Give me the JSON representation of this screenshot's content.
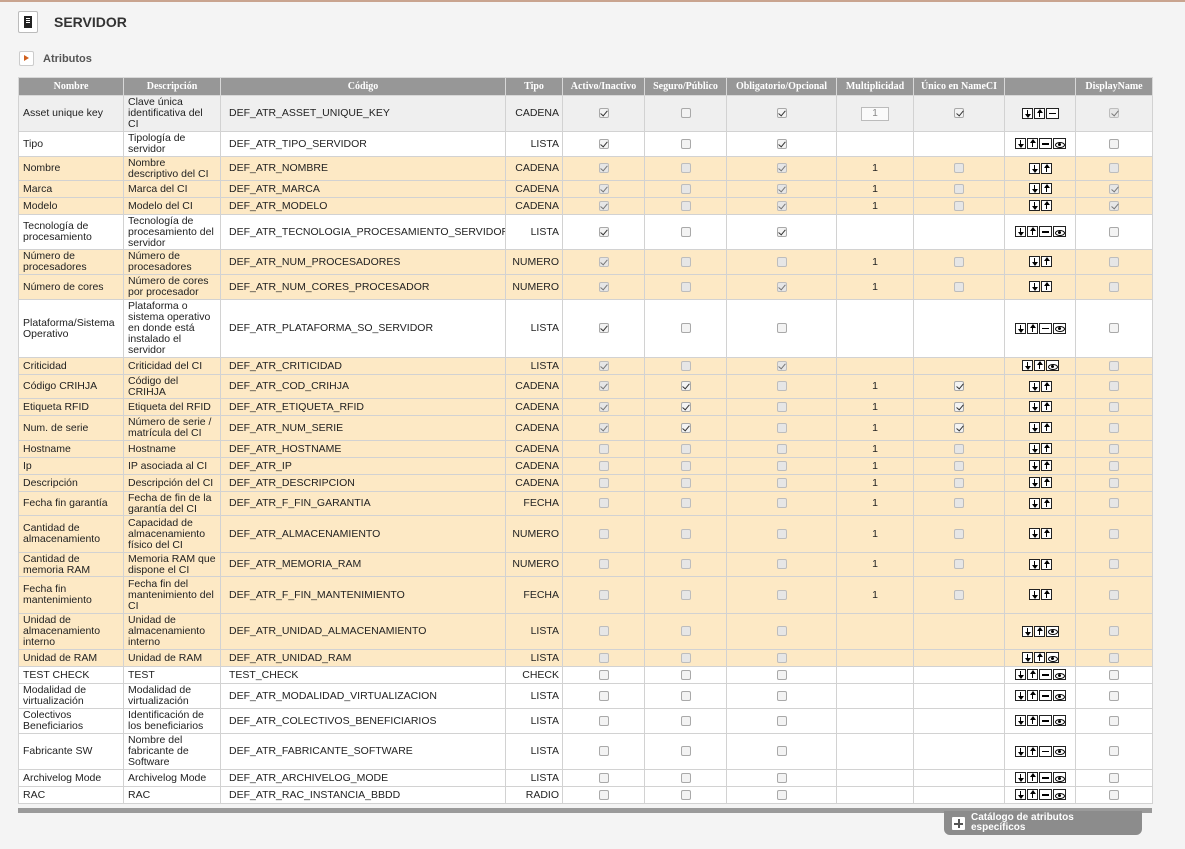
{
  "page": {
    "title": "SERVIDOR",
    "section_label": "Atributos"
  },
  "columns": [
    "Nombre",
    "Descripción",
    "Código",
    "Tipo",
    "Activo/Inactivo",
    "Seguro/Público",
    "Obligatorio/Opcional",
    "Multiplicidad",
    "Único en NameCI",
    "",
    "DisplayName"
  ],
  "rows": [
    {
      "nombre": "Asset unique key",
      "descripcion": "Clave única identificativa del CI",
      "codigo": "DEF_ATR_ASSET_UNIQUE_KEY",
      "tipo": "CADENA",
      "activo": true,
      "activo_dis": false,
      "seguro": false,
      "seguro_dis": false,
      "obligatorio": true,
      "obligatorio_dis": false,
      "mult": "1",
      "mult_box": true,
      "unico": true,
      "unico_show": true,
      "unico_dis": false,
      "actions": [
        "down",
        "up",
        "minus"
      ],
      "display": true,
      "display_dis": true,
      "style": "gray",
      "h": 36
    },
    {
      "nombre": "Tipo",
      "descripcion": "Tipología de servidor",
      "codigo": "DEF_ATR_TIPO_SERVIDOR",
      "tipo": "LISTA",
      "activo": true,
      "activo_dis": false,
      "seguro": false,
      "seguro_dis": false,
      "obligatorio": true,
      "obligatorio_dis": false,
      "mult": "",
      "mult_box": false,
      "unico": false,
      "unico_show": false,
      "unico_dis": false,
      "actions": [
        "down",
        "up",
        "minus",
        "eye"
      ],
      "display": false,
      "display_dis": false,
      "style": "white",
      "h": 25
    },
    {
      "nombre": "Nombre",
      "descripcion": "Nombre descriptivo del CI",
      "codigo": "DEF_ATR_NOMBRE",
      "tipo": "CADENA",
      "activo": true,
      "activo_dis": true,
      "seguro": false,
      "seguro_dis": true,
      "obligatorio": true,
      "obligatorio_dis": true,
      "mult": "1",
      "mult_box": false,
      "unico": false,
      "unico_show": true,
      "unico_dis": true,
      "actions": [
        "down",
        "up"
      ],
      "display": false,
      "display_dis": true,
      "style": "orange",
      "h": 24
    },
    {
      "nombre": "Marca",
      "descripcion": "Marca del CI",
      "codigo": "DEF_ATR_MARCA",
      "tipo": "CADENA",
      "activo": true,
      "activo_dis": true,
      "seguro": false,
      "seguro_dis": true,
      "obligatorio": true,
      "obligatorio_dis": true,
      "mult": "1",
      "mult_box": false,
      "unico": false,
      "unico_show": true,
      "unico_dis": true,
      "actions": [
        "down",
        "up"
      ],
      "display": true,
      "display_dis": true,
      "style": "orange",
      "h": 17
    },
    {
      "nombre": "Modelo",
      "descripcion": "Modelo del CI",
      "codigo": "DEF_ATR_MODELO",
      "tipo": "CADENA",
      "activo": true,
      "activo_dis": true,
      "seguro": false,
      "seguro_dis": true,
      "obligatorio": true,
      "obligatorio_dis": true,
      "mult": "1",
      "mult_box": false,
      "unico": false,
      "unico_show": true,
      "unico_dis": true,
      "actions": [
        "down",
        "up"
      ],
      "display": true,
      "display_dis": true,
      "style": "orange",
      "h": 17
    },
    {
      "nombre": "Tecnología de procesamiento",
      "descripcion": "Tecnología de procesamiento del servidor",
      "codigo": "DEF_ATR_TECNOLOGIA_PROCESAMIENTO_SERVIDOR",
      "tipo": "LISTA",
      "activo": true,
      "activo_dis": false,
      "seguro": false,
      "seguro_dis": false,
      "obligatorio": true,
      "obligatorio_dis": false,
      "mult": "",
      "mult_box": false,
      "unico": false,
      "unico_show": false,
      "unico_dis": false,
      "actions": [
        "down",
        "up",
        "minus",
        "eye"
      ],
      "display": false,
      "display_dis": false,
      "style": "white",
      "h": 35
    },
    {
      "nombre": "Número de procesadores",
      "descripcion": "Número de procesadores",
      "codigo": "DEF_ATR_NUM_PROCESADORES",
      "tipo": "NUMERO",
      "activo": true,
      "activo_dis": true,
      "seguro": false,
      "seguro_dis": true,
      "obligatorio": false,
      "obligatorio_dis": true,
      "mult": "1",
      "mult_box": false,
      "unico": false,
      "unico_show": true,
      "unico_dis": true,
      "actions": [
        "down",
        "up"
      ],
      "display": false,
      "display_dis": true,
      "style": "orange",
      "h": 25
    },
    {
      "nombre": "Número de cores",
      "descripcion": "Número de cores por procesador",
      "codigo": "DEF_ATR_NUM_CORES_PROCESADOR",
      "tipo": "NUMERO",
      "activo": true,
      "activo_dis": true,
      "seguro": false,
      "seguro_dis": true,
      "obligatorio": true,
      "obligatorio_dis": true,
      "mult": "1",
      "mult_box": false,
      "unico": false,
      "unico_show": true,
      "unico_dis": true,
      "actions": [
        "down",
        "up"
      ],
      "display": false,
      "display_dis": true,
      "style": "orange",
      "h": 25
    },
    {
      "nombre": "Plataforma/Sistema Operativo",
      "descripcion": "Plataforma o sistema operativo en donde está instalado el servidor",
      "codigo": "DEF_ATR_PLATAFORMA_SO_SERVIDOR",
      "tipo": "LISTA",
      "activo": true,
      "activo_dis": false,
      "seguro": false,
      "seguro_dis": false,
      "obligatorio": false,
      "obligatorio_dis": false,
      "mult": "",
      "mult_box": false,
      "unico": false,
      "unico_show": false,
      "unico_dis": false,
      "actions": [
        "down",
        "up",
        "minus",
        "eye"
      ],
      "display": false,
      "display_dis": false,
      "style": "white",
      "h": 58
    },
    {
      "nombre": "Criticidad",
      "descripcion": "Criticidad del CI",
      "codigo": "DEF_ATR_CRITICIDAD",
      "tipo": "LISTA",
      "activo": true,
      "activo_dis": true,
      "seguro": false,
      "seguro_dis": true,
      "obligatorio": true,
      "obligatorio_dis": true,
      "mult": "",
      "mult_box": false,
      "unico": false,
      "unico_show": false,
      "unico_dis": false,
      "actions": [
        "down",
        "up",
        "eye"
      ],
      "display": false,
      "display_dis": true,
      "style": "orange",
      "h": 17
    },
    {
      "nombre": "Código CRIHJA",
      "descripcion": "Código del CRIHJA",
      "codigo": "DEF_ATR_COD_CRIHJA",
      "tipo": "CADENA",
      "activo": true,
      "activo_dis": true,
      "seguro": true,
      "seguro_dis": false,
      "obligatorio": false,
      "obligatorio_dis": true,
      "mult": "1",
      "mult_box": false,
      "unico": true,
      "unico_show": true,
      "unico_dis": false,
      "actions": [
        "down",
        "up"
      ],
      "display": false,
      "display_dis": true,
      "style": "orange",
      "h": 24
    },
    {
      "nombre": "Etiqueta RFID",
      "descripcion": "Etiqueta del RFID",
      "codigo": "DEF_ATR_ETIQUETA_RFID",
      "tipo": "CADENA",
      "activo": true,
      "activo_dis": true,
      "seguro": true,
      "seguro_dis": false,
      "obligatorio": false,
      "obligatorio_dis": true,
      "mult": "1",
      "mult_box": false,
      "unico": true,
      "unico_show": true,
      "unico_dis": false,
      "actions": [
        "down",
        "up"
      ],
      "display": false,
      "display_dis": true,
      "style": "orange",
      "h": 17
    },
    {
      "nombre": "Num. de serie",
      "descripcion": "Número de serie / matrícula del CI",
      "codigo": "DEF_ATR_NUM_SERIE",
      "tipo": "CADENA",
      "activo": true,
      "activo_dis": true,
      "seguro": true,
      "seguro_dis": false,
      "obligatorio": false,
      "obligatorio_dis": true,
      "mult": "1",
      "mult_box": false,
      "unico": true,
      "unico_show": true,
      "unico_dis": false,
      "actions": [
        "down",
        "up"
      ],
      "display": false,
      "display_dis": true,
      "style": "orange",
      "h": 25
    },
    {
      "nombre": "Hostname",
      "descripcion": "Hostname",
      "codigo": "DEF_ATR_HOSTNAME",
      "tipo": "CADENA",
      "activo": false,
      "activo_dis": true,
      "seguro": false,
      "seguro_dis": true,
      "obligatorio": false,
      "obligatorio_dis": true,
      "mult": "1",
      "mult_box": false,
      "unico": false,
      "unico_show": true,
      "unico_dis": true,
      "actions": [
        "down",
        "up"
      ],
      "display": false,
      "display_dis": true,
      "style": "orange",
      "h": 17
    },
    {
      "nombre": "Ip",
      "descripcion": "IP asociada al CI",
      "codigo": "DEF_ATR_IP",
      "tipo": "CADENA",
      "activo": false,
      "activo_dis": true,
      "seguro": false,
      "seguro_dis": true,
      "obligatorio": false,
      "obligatorio_dis": true,
      "mult": "1",
      "mult_box": false,
      "unico": false,
      "unico_show": true,
      "unico_dis": true,
      "actions": [
        "down",
        "up"
      ],
      "display": false,
      "display_dis": true,
      "style": "orange",
      "h": 17
    },
    {
      "nombre": "Descripción",
      "descripcion": "Descripción del CI",
      "codigo": "DEF_ATR_DESCRIPCION",
      "tipo": "CADENA",
      "activo": false,
      "activo_dis": true,
      "seguro": false,
      "seguro_dis": true,
      "obligatorio": false,
      "obligatorio_dis": true,
      "mult": "1",
      "mult_box": false,
      "unico": false,
      "unico_show": true,
      "unico_dis": true,
      "actions": [
        "down",
        "up"
      ],
      "display": false,
      "display_dis": true,
      "style": "orange",
      "h": 17
    },
    {
      "nombre": "Fecha fin garantía",
      "descripcion": "Fecha de fin de la garantía del CI",
      "codigo": "DEF_ATR_F_FIN_GARANTIA",
      "tipo": "FECHA",
      "activo": false,
      "activo_dis": true,
      "seguro": false,
      "seguro_dis": true,
      "obligatorio": false,
      "obligatorio_dis": true,
      "mult": "1",
      "mult_box": false,
      "unico": false,
      "unico_show": true,
      "unico_dis": true,
      "actions": [
        "down",
        "up"
      ],
      "display": false,
      "display_dis": true,
      "style": "orange",
      "h": 24
    },
    {
      "nombre": "Cantidad de almacenamiento",
      "descripcion": "Capacidad de almacenamiento físico del CI",
      "codigo": "DEF_ATR_ALMACENAMIENTO",
      "tipo": "NUMERO",
      "activo": false,
      "activo_dis": true,
      "seguro": false,
      "seguro_dis": true,
      "obligatorio": false,
      "obligatorio_dis": true,
      "mult": "1",
      "mult_box": false,
      "unico": false,
      "unico_show": true,
      "unico_dis": true,
      "actions": [
        "down",
        "up"
      ],
      "display": false,
      "display_dis": true,
      "style": "orange",
      "h": 37
    },
    {
      "nombre": "Cantidad de memoria RAM",
      "descripcion": "Memoria RAM que dispone el CI",
      "codigo": "DEF_ATR_MEMORIA_RAM",
      "tipo": "NUMERO",
      "activo": false,
      "activo_dis": true,
      "seguro": false,
      "seguro_dis": true,
      "obligatorio": false,
      "obligatorio_dis": true,
      "mult": "1",
      "mult_box": false,
      "unico": false,
      "unico_show": true,
      "unico_dis": true,
      "actions": [
        "down",
        "up"
      ],
      "display": false,
      "display_dis": true,
      "style": "orange",
      "h": 24
    },
    {
      "nombre": "Fecha fin mantenimiento",
      "descripcion": "Fecha fin del mantenimiento del CI",
      "codigo": "DEF_ATR_F_FIN_MANTENIMIENTO",
      "tipo": "FECHA",
      "activo": false,
      "activo_dis": true,
      "seguro": false,
      "seguro_dis": true,
      "obligatorio": false,
      "obligatorio_dis": true,
      "mult": "1",
      "mult_box": false,
      "unico": false,
      "unico_show": true,
      "unico_dis": true,
      "actions": [
        "down",
        "up"
      ],
      "display": false,
      "display_dis": true,
      "style": "orange",
      "h": 37
    },
    {
      "nombre": "Unidad de almacenamiento interno",
      "descripcion": "Unidad de almacenamiento interno",
      "codigo": "DEF_ATR_UNIDAD_ALMACENAMIENTO",
      "tipo": "LISTA",
      "activo": false,
      "activo_dis": true,
      "seguro": false,
      "seguro_dis": true,
      "obligatorio": false,
      "obligatorio_dis": true,
      "mult": "",
      "mult_box": false,
      "unico": false,
      "unico_show": false,
      "unico_dis": false,
      "actions": [
        "down",
        "up",
        "eye"
      ],
      "display": false,
      "display_dis": true,
      "style": "orange",
      "h": 36
    },
    {
      "nombre": "Unidad de RAM",
      "descripcion": "Unidad de RAM",
      "codigo": "DEF_ATR_UNIDAD_RAM",
      "tipo": "LISTA",
      "activo": false,
      "activo_dis": true,
      "seguro": false,
      "seguro_dis": true,
      "obligatorio": false,
      "obligatorio_dis": true,
      "mult": "",
      "mult_box": false,
      "unico": false,
      "unico_show": false,
      "unico_dis": false,
      "actions": [
        "down",
        "up",
        "eye"
      ],
      "display": false,
      "display_dis": true,
      "style": "orange",
      "h": 17
    },
    {
      "nombre": "TEST CHECK",
      "descripcion": "TEST",
      "codigo": "TEST_CHECK",
      "tipo": "CHECK",
      "activo": false,
      "activo_dis": false,
      "seguro": false,
      "seguro_dis": false,
      "obligatorio": false,
      "obligatorio_dis": false,
      "mult": "",
      "mult_box": false,
      "unico": false,
      "unico_show": false,
      "unico_dis": false,
      "actions": [
        "down",
        "up",
        "minus",
        "eye"
      ],
      "display": false,
      "display_dis": false,
      "style": "white",
      "h": 17
    },
    {
      "nombre": "Modalidad de virtualización",
      "descripcion": "Modalidad de virtualización",
      "codigo": "DEF_ATR_MODALIDAD_VIRTUALIZACION",
      "tipo": "LISTA",
      "activo": false,
      "activo_dis": false,
      "seguro": false,
      "seguro_dis": false,
      "obligatorio": false,
      "obligatorio_dis": false,
      "mult": "",
      "mult_box": false,
      "unico": false,
      "unico_show": false,
      "unico_dis": false,
      "actions": [
        "down",
        "up",
        "minus",
        "eye"
      ],
      "display": false,
      "display_dis": false,
      "style": "white",
      "h": 25
    },
    {
      "nombre": "Colectivos Beneficiarios",
      "descripcion": "Identificación de los beneficiarios",
      "codigo": "DEF_ATR_COLECTIVOS_BENEFICIARIOS",
      "tipo": "LISTA",
      "activo": false,
      "activo_dis": false,
      "seguro": false,
      "seguro_dis": false,
      "obligatorio": false,
      "obligatorio_dis": false,
      "mult": "",
      "mult_box": false,
      "unico": false,
      "unico_show": false,
      "unico_dis": false,
      "actions": [
        "down",
        "up",
        "minus",
        "eye"
      ],
      "display": false,
      "display_dis": false,
      "style": "white",
      "h": 25
    },
    {
      "nombre": "Fabricante SW",
      "descripcion": "Nombre del fabricante de Software",
      "codigo": "DEF_ATR_FABRICANTE_SOFTWARE",
      "tipo": "LISTA",
      "activo": false,
      "activo_dis": false,
      "seguro": false,
      "seguro_dis": false,
      "obligatorio": false,
      "obligatorio_dis": false,
      "mult": "",
      "mult_box": false,
      "unico": false,
      "unico_show": false,
      "unico_dis": false,
      "actions": [
        "down",
        "up",
        "minus",
        "eye"
      ],
      "display": false,
      "display_dis": false,
      "style": "white",
      "h": 36
    },
    {
      "nombre": "Archivelog Mode",
      "descripcion": "Archivelog Mode",
      "codigo": "DEF_ATR_ARCHIVELOG_MODE",
      "tipo": "LISTA",
      "activo": false,
      "activo_dis": false,
      "seguro": false,
      "seguro_dis": false,
      "obligatorio": false,
      "obligatorio_dis": false,
      "mult": "",
      "mult_box": false,
      "unico": false,
      "unico_show": false,
      "unico_dis": false,
      "actions": [
        "down",
        "up",
        "minus",
        "eye"
      ],
      "display": false,
      "display_dis": false,
      "style": "white",
      "h": 17
    },
    {
      "nombre": "RAC",
      "descripcion": "RAC",
      "codigo": "DEF_ATR_RAC_INSTANCIA_BBDD",
      "tipo": "RADIO",
      "activo": false,
      "activo_dis": false,
      "seguro": false,
      "seguro_dis": false,
      "obligatorio": false,
      "obligatorio_dis": false,
      "mult": "",
      "mult_box": false,
      "unico": false,
      "unico_show": false,
      "unico_dis": false,
      "actions": [
        "down",
        "up",
        "minus",
        "eye"
      ],
      "display": false,
      "display_dis": false,
      "style": "white",
      "h": 17
    }
  ],
  "footer": {
    "catalog_label": "Catálogo de atributos específicos"
  },
  "icons": {
    "header": "server-icon",
    "section": "expand-arrow-icon",
    "row_actions": [
      "move-down-icon",
      "move-up-icon",
      "remove-icon",
      "view-icon"
    ],
    "catalog": "plus-icon"
  }
}
